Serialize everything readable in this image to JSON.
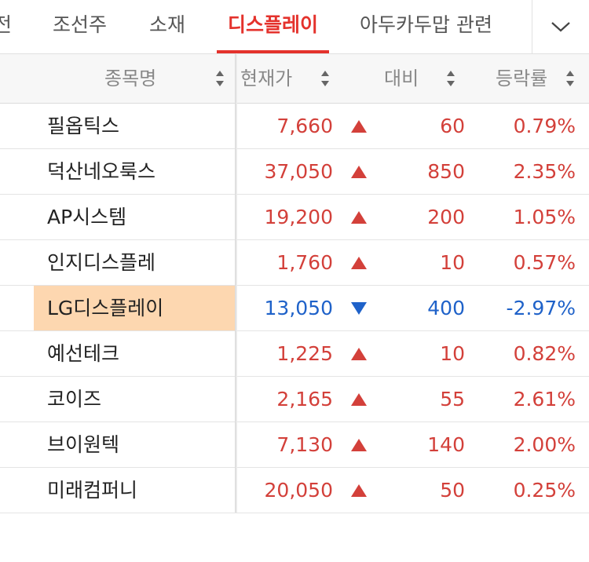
{
  "tabs": [
    {
      "label": "전",
      "active": false
    },
    {
      "label": "조선주",
      "active": false
    },
    {
      "label": "소재",
      "active": false
    },
    {
      "label": "디스플레이",
      "active": true
    },
    {
      "label": "아두카두맙 관련",
      "active": false
    }
  ],
  "header": {
    "name": "종목명",
    "price": "현재가",
    "diff": "대비",
    "rate": "등락률"
  },
  "colors": {
    "up": "#d3403a",
    "down": "#1f62c9",
    "accent": "#e4322c",
    "highlight": "#fdd7b0"
  },
  "rows": [
    {
      "name": "필옵틱스",
      "price": "7,660",
      "dir": "up",
      "diff": "60",
      "rate": "0.79%"
    },
    {
      "name": "덕산네오룩스",
      "price": "37,050",
      "dir": "up",
      "diff": "850",
      "rate": "2.35%"
    },
    {
      "name": "AP시스템",
      "price": "19,200",
      "dir": "up",
      "diff": "200",
      "rate": "1.05%"
    },
    {
      "name": "인지디스플레",
      "price": "1,760",
      "dir": "up",
      "diff": "10",
      "rate": "0.57%"
    },
    {
      "name": "LG디스플레이",
      "price": "13,050",
      "dir": "down",
      "diff": "400",
      "rate": "-2.97%",
      "highlight": true
    },
    {
      "name": "예선테크",
      "price": "1,225",
      "dir": "up",
      "diff": "10",
      "rate": "0.82%"
    },
    {
      "name": "코이즈",
      "price": "2,165",
      "dir": "up",
      "diff": "55",
      "rate": "2.61%"
    },
    {
      "name": "브이원텍",
      "price": "7,130",
      "dir": "up",
      "diff": "140",
      "rate": "2.00%"
    },
    {
      "name": "미래컴퍼니",
      "price": "20,050",
      "dir": "up",
      "diff": "50",
      "rate": "0.25%"
    }
  ]
}
